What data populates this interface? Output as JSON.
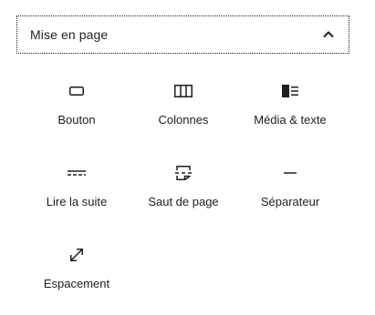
{
  "panel": {
    "title": "Mise en page",
    "toggle_icon": "chevron-up-icon",
    "expanded": true
  },
  "blocks": [
    {
      "label": "Bouton",
      "icon": "button-icon"
    },
    {
      "label": "Colonnes",
      "icon": "columns-icon"
    },
    {
      "label": "Média & texte",
      "icon": "media-text-icon"
    },
    {
      "label": "Lire la suite",
      "icon": "more-icon"
    },
    {
      "label": "Saut de page",
      "icon": "page-break-icon"
    },
    {
      "label": "Séparateur",
      "icon": "separator-icon"
    },
    {
      "label": "Espacement",
      "icon": "spacer-icon"
    }
  ],
  "colors": {
    "text": "#1e1e1e",
    "background": "#ffffff",
    "border": "#1e1e1e"
  }
}
